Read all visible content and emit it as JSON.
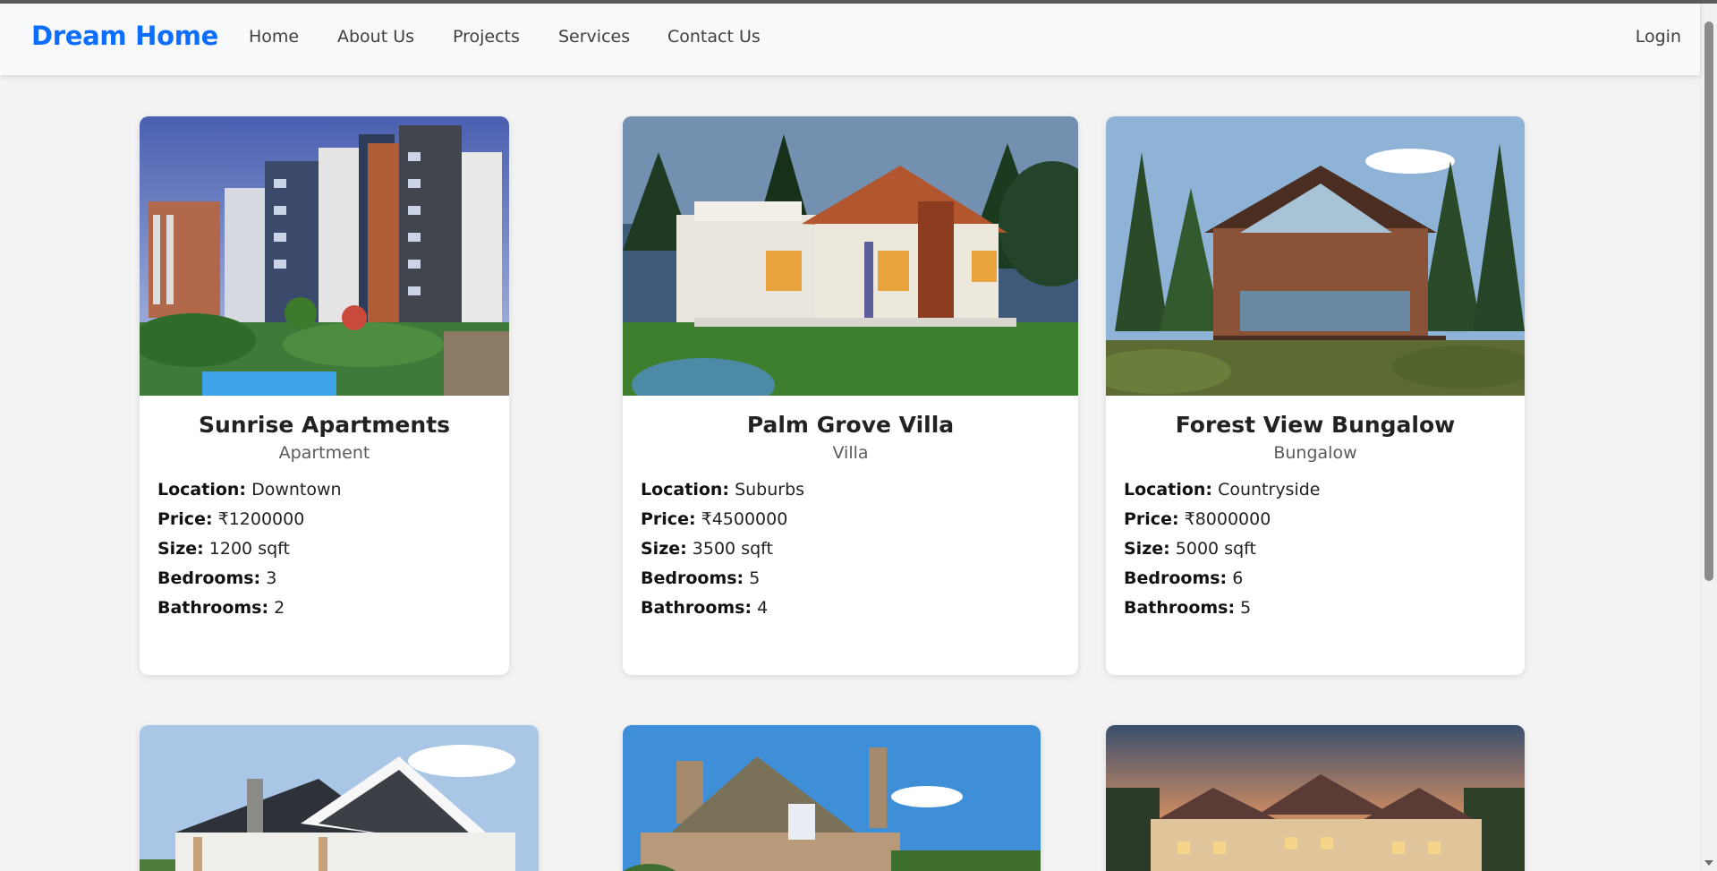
{
  "nav": {
    "brand": "Dream Home",
    "links": [
      "Home",
      "About Us",
      "Projects",
      "Services",
      "Contact Us"
    ],
    "login": "Login",
    "brand_color": "#0d6efd"
  },
  "labels": {
    "location": "Location:",
    "price": "Price:",
    "size": "Size:",
    "bedrooms": "Bedrooms:",
    "bathrooms": "Bathrooms:"
  },
  "properties": [
    {
      "title": "Sunrise Apartments",
      "type": "Apartment",
      "location": "Downtown",
      "price": "₹1200000",
      "size": "1200 sqft",
      "bedrooms": "3",
      "bathrooms": "2",
      "image_icon": "apartment-building-image"
    },
    {
      "title": "Palm Grove Villa",
      "type": "Villa",
      "location": "Suburbs",
      "price": "₹4500000",
      "size": "3500 sqft",
      "bedrooms": "5",
      "bathrooms": "4",
      "image_icon": "villa-image"
    },
    {
      "title": "Forest View Bungalow",
      "type": "Bungalow",
      "location": "Countryside",
      "price": "₹8000000",
      "size": "5000 sqft",
      "bedrooms": "6",
      "bathrooms": "5",
      "image_icon": "bungalow-image"
    }
  ],
  "partial_cards": [
    {
      "image_icon": "farmhouse-image"
    },
    {
      "image_icon": "stone-cottage-image"
    },
    {
      "image_icon": "mansion-image"
    }
  ]
}
